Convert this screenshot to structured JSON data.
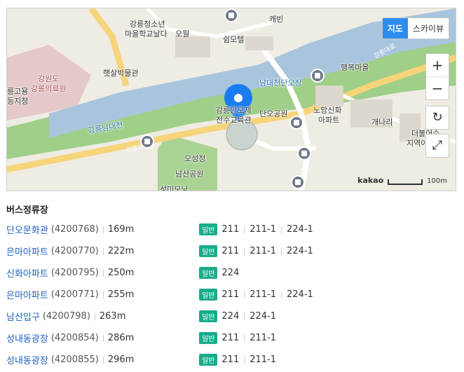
{
  "map": {
    "type_map": "지도",
    "type_skyview": "스카이뷰",
    "zoom_in": "+",
    "zoom_out": "−",
    "scale_logo": "kakao",
    "scale_text": "100m",
    "labels": {
      "youth_center": "강릉청소년",
      "school": "마을학교날다",
      "owol": "오월",
      "motel": "쉼모텔",
      "cabin": "캐빈",
      "museum": "햇살박물관",
      "hospital1": "강원도",
      "hospital2": "강릉의료원",
      "left1": "릉고용",
      "left2": "등지청",
      "river": "강릉남대천",
      "road_south": "강릉대로",
      "road_north": "강릉대로",
      "namdae": "남대천단오장",
      "happy": "행복마을",
      "center1": "강릉단오제",
      "center2": "전수교육관",
      "dano_park": "단오공원",
      "noam1": "노암신화",
      "noam2": "아파트",
      "gaenari": "개나리",
      "right1": "더불어수",
      "right2": "지역아",
      "oseong": "오성정",
      "namsan": "남산공원",
      "seongmo": "성미모닝"
    }
  },
  "section_title": "버스정류장",
  "route_badge": "일반",
  "stops": [
    {
      "name": "단오문화관",
      "id": "(4200768)",
      "distance": "169m",
      "routes": [
        "211",
        "211-1",
        "224-1"
      ]
    },
    {
      "name": "은마아파트",
      "id": "(4200770)",
      "distance": "222m",
      "routes": [
        "211",
        "211-1",
        "224-1"
      ]
    },
    {
      "name": "신화아파트",
      "id": "(4200795)",
      "distance": "250m",
      "routes": [
        "224"
      ]
    },
    {
      "name": "은마아파트",
      "id": "(4200771)",
      "distance": "255m",
      "routes": [
        "211",
        "211-1",
        "224-1"
      ]
    },
    {
      "name": "남산입구",
      "id": "(4200798)",
      "distance": "263m",
      "routes": [
        "224",
        "224-1"
      ]
    },
    {
      "name": "성내동광장",
      "id": "(4200854)",
      "distance": "286m",
      "routes": [
        "211",
        "211-1"
      ]
    },
    {
      "name": "성내동광장",
      "id": "(4200855)",
      "distance": "296m",
      "routes": [
        "211",
        "211-1"
      ]
    }
  ],
  "colors": {
    "link": "#1f5fbf",
    "badge": "#1aab8a",
    "map_active": "#2d8cf0",
    "pin": "#1a7cf2"
  }
}
